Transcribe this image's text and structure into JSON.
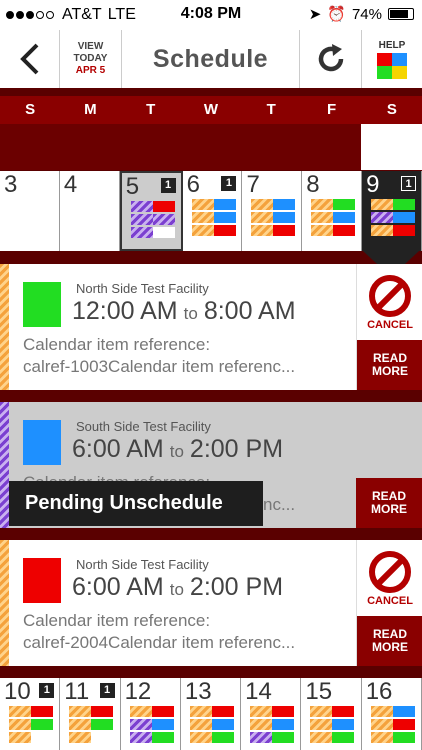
{
  "status_bar": {
    "carrier": "AT&T",
    "network": "LTE",
    "time": "4:08 PM",
    "battery": "74%"
  },
  "header": {
    "view_today_line1": "VIEW",
    "view_today_line2": "TODAY",
    "view_today_date": "APR 5",
    "title": "Schedule",
    "help_label": "HELP"
  },
  "weekdays": [
    "S",
    "M",
    "T",
    "W",
    "T",
    "F",
    "S"
  ],
  "week_top": [
    {
      "day": "3",
      "badge": ""
    },
    {
      "day": "4",
      "badge": ""
    },
    {
      "day": "5",
      "badge": "1"
    },
    {
      "day": "6",
      "badge": "1"
    },
    {
      "day": "7",
      "badge": ""
    },
    {
      "day": "8",
      "badge": ""
    },
    {
      "day": "9",
      "badge": "1"
    }
  ],
  "week_bottom": [
    {
      "day": "10",
      "badge": "1"
    },
    {
      "day": "11",
      "badge": "1"
    },
    {
      "day": "12",
      "badge": ""
    },
    {
      "day": "13",
      "badge": ""
    },
    {
      "day": "14",
      "badge": ""
    },
    {
      "day": "15",
      "badge": ""
    },
    {
      "day": "16",
      "badge": ""
    }
  ],
  "events": [
    {
      "facility": "North Side Test Facility",
      "start": "12:00 AM",
      "to": "to",
      "end": "8:00 AM",
      "ref_line1": "Calendar item reference:",
      "ref_line2": "calref-1003Calendar item referenc...",
      "cancel_label": "CANCEL",
      "read_more": "READ MORE",
      "color": "#22dd22"
    },
    {
      "facility": "South Side Test Facility",
      "start": "6:00 AM",
      "to": "to",
      "end": "2:00 PM",
      "ref_line1": "Calendar item reference:",
      "ref_line2": "calref-2003Calendar item referenc...",
      "cancel_label": "",
      "read_more": "READ MORE",
      "color": "#1e90ff"
    },
    {
      "facility": "North Side Test Facility",
      "start": "6:00 AM",
      "to": "to",
      "end": "2:00 PM",
      "ref_line1": "Calendar item reference:",
      "ref_line2": "calref-2004Calendar item referenc...",
      "cancel_label": "CANCEL",
      "read_more": "READ MORE",
      "color": "#ee0000"
    }
  ],
  "pending_banner": "Pending Unschedule"
}
